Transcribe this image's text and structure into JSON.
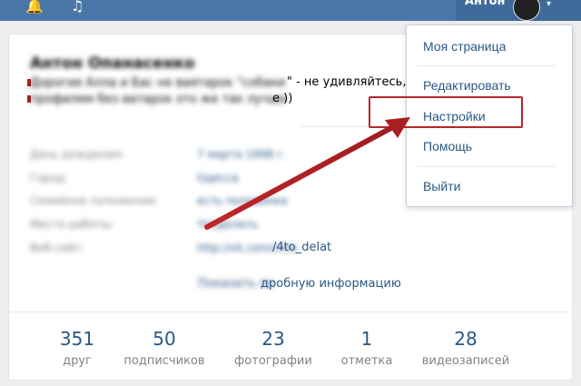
{
  "header": {
    "user_name": "Антон",
    "icons": [
      "bell-icon",
      "music-icon",
      "avatar",
      "chevron-down-icon"
    ]
  },
  "profile": {
    "name": "Антон Опанасенко",
    "status_line1_hidden": "Дорогие Алла и Бас не ваятарок \"собаки",
    "status_line1_visible": "\" - не удивляйтесь, что",
    "status_line2_hidden": "профилем без ватарок это же так лучше",
    "status_line2_visible": "e ))",
    "info_rows": [
      {
        "label": "День рождения:",
        "value": "7 марта 1998 г."
      },
      {
        "label": "Город:",
        "value": "Одесса"
      },
      {
        "label": "Семейное положение:",
        "value": "есть половинка"
      },
      {
        "label": "Место работы:",
        "value": "Чтоделать"
      },
      {
        "label": "Веб-сайт:",
        "value": "http://vk.com/chto"
      }
    ],
    "website_visible": "/4to_delat",
    "more_info_hidden": "Показать по",
    "more_info_visible": "дробную информацию"
  },
  "stats": [
    {
      "num": "351",
      "label": "друг"
    },
    {
      "num": "50",
      "label": "подписчиков"
    },
    {
      "num": "23",
      "label": "фотографии"
    },
    {
      "num": "1",
      "label": "отметка"
    },
    {
      "num": "28",
      "label": "видеозаписей"
    }
  ],
  "menu": {
    "my_page": "Моя страница",
    "edit": "Редактировать",
    "settings": "Настройки",
    "help": "Помощь",
    "logout": "Выйти"
  },
  "colors": {
    "topbar": "#4a76a8",
    "link": "#2a5885",
    "highlight": "#b5282c"
  }
}
